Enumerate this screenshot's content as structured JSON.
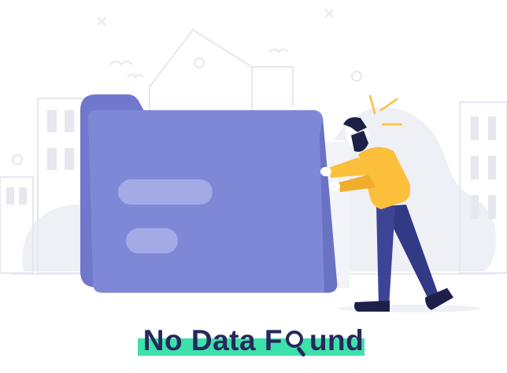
{
  "title": {
    "before": "No Data F",
    "after": "und"
  },
  "icons": [
    "folder-icon",
    "magnifier-icon",
    "person-illustration",
    "sparkle-icon",
    "city-background"
  ],
  "colors": {
    "folder_back": "#7077cc",
    "folder_front": "#7f88d6",
    "folder_bar": "#a4aae6",
    "shirt": "#fcbf3c",
    "pants": "#3c4495",
    "title_text": "#26295c",
    "highlight": "#3ee0ab",
    "background_lines": "#e6e7ef",
    "background_blob": "#eef0f5"
  }
}
